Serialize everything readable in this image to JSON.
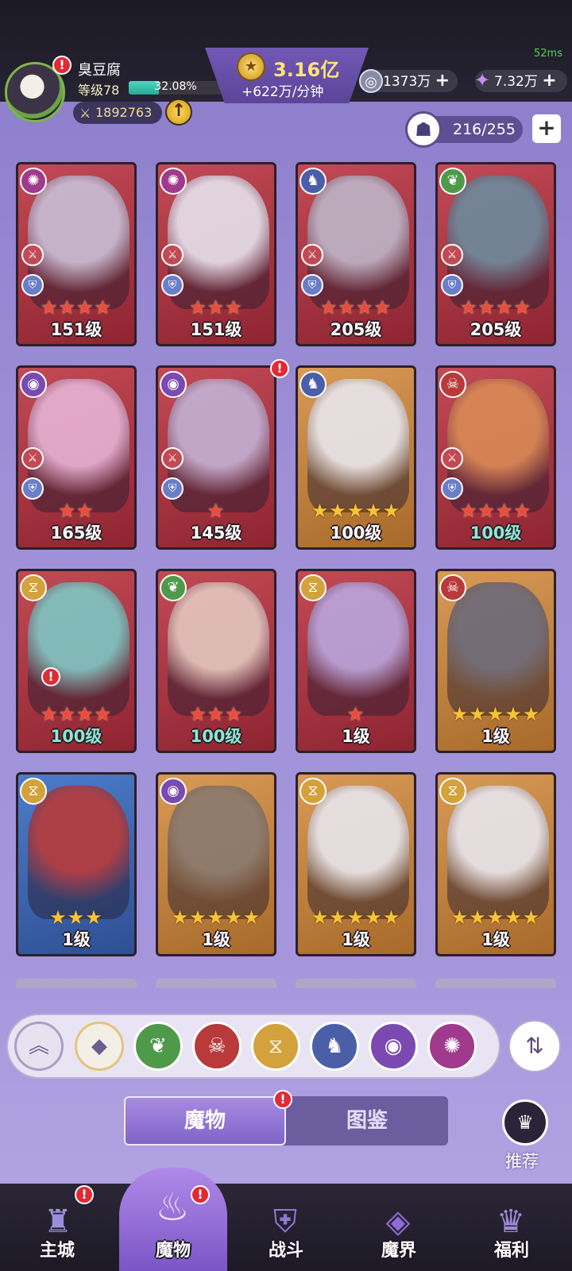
{
  "player": {
    "name": "臭豆腐",
    "level": "等级78",
    "xp_text": "32.08%",
    "xp_fraction": 0.3208,
    "power": "1892763"
  },
  "ping": "52ms",
  "gold": {
    "value": "3.16亿",
    "rate": "+622万/分钟"
  },
  "resources": [
    {
      "icon": "silver-coin-icon",
      "value": "1373万"
    },
    {
      "icon": "crystal-icon",
      "value": "7.32万"
    }
  ],
  "capacity": "216/255",
  "cards": [
    {
      "frame": "red",
      "faction": "wind",
      "level": "151级",
      "stars": 4,
      "star_color": "red",
      "level_color": "white"
    },
    {
      "frame": "red",
      "faction": "wind",
      "level": "151级",
      "stars": 3,
      "star_color": "red",
      "level_color": "white"
    },
    {
      "frame": "red",
      "faction": "wolf",
      "level": "205级",
      "stars": 4,
      "star_color": "red",
      "level_color": "white"
    },
    {
      "frame": "red",
      "faction": "leaf",
      "level": "205级",
      "stars": 4,
      "star_color": "red",
      "level_color": "white"
    },
    {
      "frame": "red",
      "faction": "eye",
      "level": "165级",
      "stars": 2,
      "star_color": "red",
      "level_color": "white"
    },
    {
      "frame": "red",
      "faction": "eye",
      "level": "145级",
      "stars": 1,
      "star_color": "red",
      "level_color": "white"
    },
    {
      "frame": "gold",
      "faction": "wolf",
      "level": "100级",
      "stars": 5,
      "star_color": "gold",
      "level_color": "white"
    },
    {
      "frame": "red",
      "faction": "demon",
      "level": "100级",
      "stars": 4,
      "star_color": "red",
      "level_color": "teal"
    },
    {
      "frame": "red",
      "faction": "hourglass",
      "level": "100级",
      "stars": 4,
      "star_color": "red",
      "level_color": "teal"
    },
    {
      "frame": "red",
      "faction": "leaf",
      "level": "100级",
      "stars": 3,
      "star_color": "red",
      "level_color": "teal"
    },
    {
      "frame": "red",
      "faction": "hourglass",
      "level": "1级",
      "stars": 1,
      "star_color": "red",
      "level_color": "white"
    },
    {
      "frame": "gold",
      "faction": "demon",
      "level": "1级",
      "stars": 5,
      "star_color": "gold",
      "level_color": "white"
    },
    {
      "frame": "blue",
      "faction": "hourglass",
      "level": "1级",
      "stars": 3,
      "star_color": "gold",
      "level_color": "white"
    },
    {
      "frame": "gold",
      "faction": "eye",
      "level": "1级",
      "stars": 5,
      "star_color": "gold",
      "level_color": "white"
    },
    {
      "frame": "gold",
      "faction": "hourglass",
      "level": "1级",
      "stars": 5,
      "star_color": "gold",
      "level_color": "white"
    },
    {
      "frame": "gold",
      "faction": "hourglass",
      "level": "1级",
      "stars": 5,
      "star_color": "gold",
      "level_color": "white"
    }
  ],
  "filters": [
    {
      "icon": "collapse-up-icon"
    },
    {
      "icon": "all-factions-icon"
    },
    {
      "icon": "leaf-faction-icon"
    },
    {
      "icon": "demon-faction-icon"
    },
    {
      "icon": "hourglass-faction-icon"
    },
    {
      "icon": "wolf-faction-icon"
    },
    {
      "icon": "eye-faction-icon"
    },
    {
      "icon": "wind-faction-icon"
    }
  ],
  "tabs": {
    "monsters": "魔物",
    "codex": "图鉴"
  },
  "recommend": "推荐",
  "nav": [
    {
      "label": "主城",
      "icon": "castle-icon"
    },
    {
      "label": "魔物",
      "icon": "flame-icon"
    },
    {
      "label": "战斗",
      "icon": "shield-sword-icon"
    },
    {
      "label": "魔界",
      "icon": "portal-icon"
    },
    {
      "label": "福利",
      "icon": "treasure-chest-icon"
    }
  ]
}
